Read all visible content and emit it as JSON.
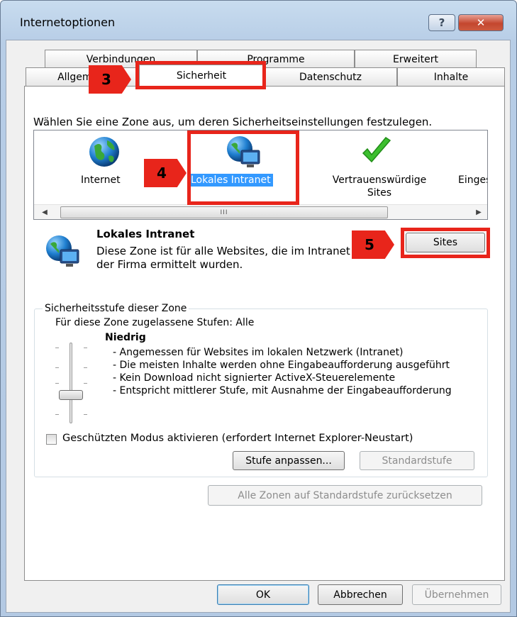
{
  "window": {
    "title": "Internetoptionen",
    "help_label": "?",
    "close_label": "✕"
  },
  "tabs": {
    "row1": [
      "Verbindungen",
      "Programme",
      "Erweitert"
    ],
    "row2": [
      "Allgemein",
      "Sicherheit",
      "Datenschutz",
      "Inhalte"
    ],
    "selected": "Sicherheit"
  },
  "security": {
    "zone_instruction": "Wählen Sie eine Zone aus, um deren Sicherheitseinstellungen festzulegen.",
    "zones": [
      {
        "label": "Internet",
        "icon": "globe-icon"
      },
      {
        "label": "Lokales Intranet",
        "icon": "intranet-icon",
        "selected": true
      },
      {
        "label": "Vertrauenswürdige Sites",
        "icon": "checkmark-icon"
      },
      {
        "label": "Eingeschränkte Sites",
        "icon": "restricted-icon"
      }
    ],
    "scroll_grip": "III",
    "selected_zone": {
      "name": "Lokales Intranet",
      "description": "Diese Zone ist für alle Websites, die im Intranet der Firma ermittelt wurden.",
      "icon": "intranet-icon"
    },
    "sites_button": "Sites",
    "level_group": {
      "legend": "Sicherheitsstufe dieser Zone",
      "allowed": "Für diese Zone zugelassene Stufen: Alle",
      "level_name": "Niedrig",
      "bullets": [
        "- Angemessen für Websites im lokalen Netzwerk (Intranet)",
        "- Die meisten Inhalte werden ohne Eingabeaufforderung ausgeführt",
        "- Kein Download nicht signierter ActiveX-Steuerelemente",
        "- Entspricht mittlerer Stufe, mit Ausnahme der Eingabeaufforderung"
      ],
      "slider_position": "Niedrig",
      "protected_mode": {
        "label": "Geschützten Modus aktivieren (erfordert Internet Explorer-Neustart)",
        "checked": false
      },
      "custom_button": "Stufe anpassen...",
      "default_button": "Standardstufe"
    },
    "reset_all_button": "Alle Zonen auf Standardstufe zurücksetzen"
  },
  "footer": {
    "ok": "OK",
    "cancel": "Abbrechen",
    "apply": "Übernehmen"
  },
  "annotations": [
    {
      "number": "3",
      "target": "tab-sicherheit"
    },
    {
      "number": "4",
      "target": "zone-lokales-intranet"
    },
    {
      "number": "5",
      "target": "sites-button"
    }
  ],
  "colors": {
    "annotation_red": "#e8251b",
    "selection_blue": "#3399ff",
    "window_frame": "#b7cde6"
  }
}
